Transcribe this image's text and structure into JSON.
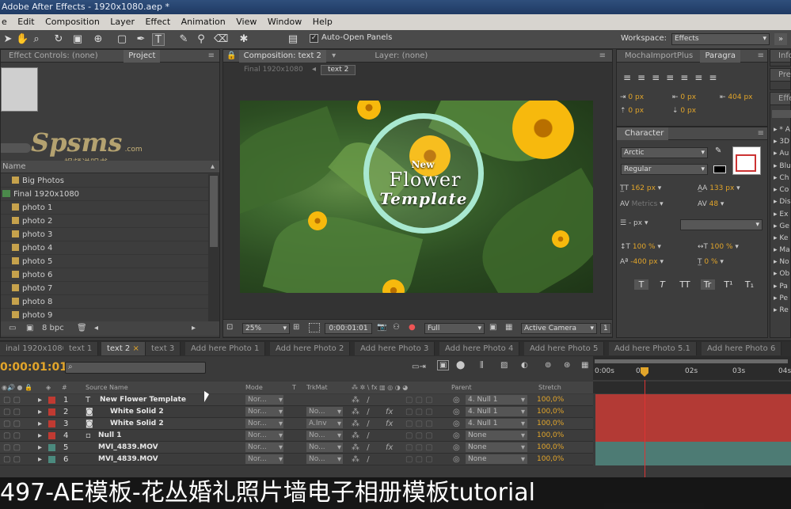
{
  "app": {
    "title": "Adobe After Effects - 1920x1080.aep *"
  },
  "menu": [
    "e",
    "Edit",
    "Composition",
    "Layer",
    "Effect",
    "Animation",
    "View",
    "Window",
    "Help"
  ],
  "toolbar": {
    "auto_open_label": "Auto-Open Panels",
    "workspace_label": "Workspace:",
    "workspace_value": "Effects"
  },
  "left_panels": {
    "effect_controls_tab": "Effect Controls: (none)",
    "project_tab": "Project"
  },
  "project": {
    "column_name": "Name",
    "items": [
      "Big Photos",
      "Final 1920x1080",
      "photo 1",
      "photo 2",
      "photo 3",
      "photo 4",
      "photo 5",
      "photo 6",
      "photo 7",
      "photo 8",
      "photo 9"
    ],
    "bpc": "8 bpc"
  },
  "watermark": {
    "brand": "Spsms",
    "domain": ".com",
    "sub": "视频说明书"
  },
  "composition": {
    "tab": "Composition: text 2",
    "layer_tab": "Layer: (none)",
    "breadcrumb_parent": "Final 1920x1080",
    "breadcrumb_current": "text 2",
    "zoom": "25%",
    "timecode": "0:00:01:01",
    "resolution": "Full",
    "camera": "Active Camera",
    "views": "1"
  },
  "artwork": {
    "new": "New",
    "flower": "Flower",
    "template": "Template"
  },
  "right_tabs": {
    "mocha": "MochaImportPlus",
    "paragraph": "Paragra",
    "info": "Info",
    "preview": "Pre",
    "effects": "Effe"
  },
  "paragraph": {
    "indent_left": "0 px",
    "indent_first": "0 px",
    "indent_right": "404 px",
    "space_before": "0 px",
    "space_after": "0 px"
  },
  "character": {
    "tab": "Character",
    "font": "Arctic",
    "style": "Regular",
    "size": "162 px",
    "leading": "133 px",
    "kerning": "Metrics",
    "tracking": "48",
    "stroke": "- px",
    "vscale": "100 %",
    "hscale": "100 %",
    "baseline": "-400 px",
    "tsume": "0 %",
    "style_buttons": [
      "T",
      "T",
      "TT",
      "Tr",
      "T¹",
      "T₁"
    ]
  },
  "effects_list": [
    "* A",
    "3D",
    "Au",
    "Blu",
    "Ch",
    "Co",
    "Dis",
    "Ex",
    "Ge",
    "Ke",
    "Ma",
    "No",
    "Ob",
    "Pa",
    "Pe",
    "Re"
  ],
  "timeline": {
    "tabs": [
      "inal 1920x1080",
      "text 1",
      "text 2",
      "text 3",
      "Add here Photo 1",
      "Add here Photo 2",
      "Add here Photo 3",
      "Add here Photo 4",
      "Add here Photo 5",
      "Add here Photo 5.1",
      "Add here Photo 6"
    ],
    "active_tab": "text 2",
    "timecode": "0:00:01:01",
    "col_source": "Source Name",
    "col_mode": "Mode",
    "col_t": "T",
    "col_trkmat": "TrkMat",
    "col_parent": "Parent",
    "col_stretch": "Stretch",
    "ruler": [
      "0:00s",
      "01s",
      "02s",
      "03s",
      "04s"
    ],
    "layers": [
      {
        "num": "1",
        "name": "New Flower Template",
        "mode": "Nor...",
        "trkmat": "",
        "parent": "4. Null 1",
        "stretch": "100,0%",
        "color": "#c03a32",
        "type": "T",
        "fx": false
      },
      {
        "num": "2",
        "name": "White Solid 2",
        "mode": "Nor...",
        "trkmat": "No...",
        "parent": "4. Null 1",
        "stretch": "100,0%",
        "color": "#c03a32",
        "type": "solid",
        "fx": true
      },
      {
        "num": "3",
        "name": "White Solid 2",
        "mode": "Nor...",
        "trkmat": "A.Inv",
        "parent": "4. Null 1",
        "stretch": "100,0%",
        "color": "#c03a32",
        "type": "solid",
        "fx": true
      },
      {
        "num": "4",
        "name": "Null 1",
        "mode": "Nor...",
        "trkmat": "No...",
        "parent": "None",
        "stretch": "100,0%",
        "color": "#c03a32",
        "type": "null",
        "fx": false
      },
      {
        "num": "5",
        "name": "MVI_4839.MOV",
        "mode": "Nor...",
        "trkmat": "No...",
        "parent": "None",
        "stretch": "100,0%",
        "color": "#4b8a7e",
        "type": "video",
        "fx": true
      },
      {
        "num": "6",
        "name": "MVI_4839.MOV",
        "mode": "Nor...",
        "trkmat": "No...",
        "parent": "None",
        "stretch": "100,0%",
        "color": "#4b8a7e",
        "type": "video",
        "fx": false
      }
    ]
  },
  "subtitle": "497-AE模板-花丛婚礼照片墙电子相册模板tutorial"
}
